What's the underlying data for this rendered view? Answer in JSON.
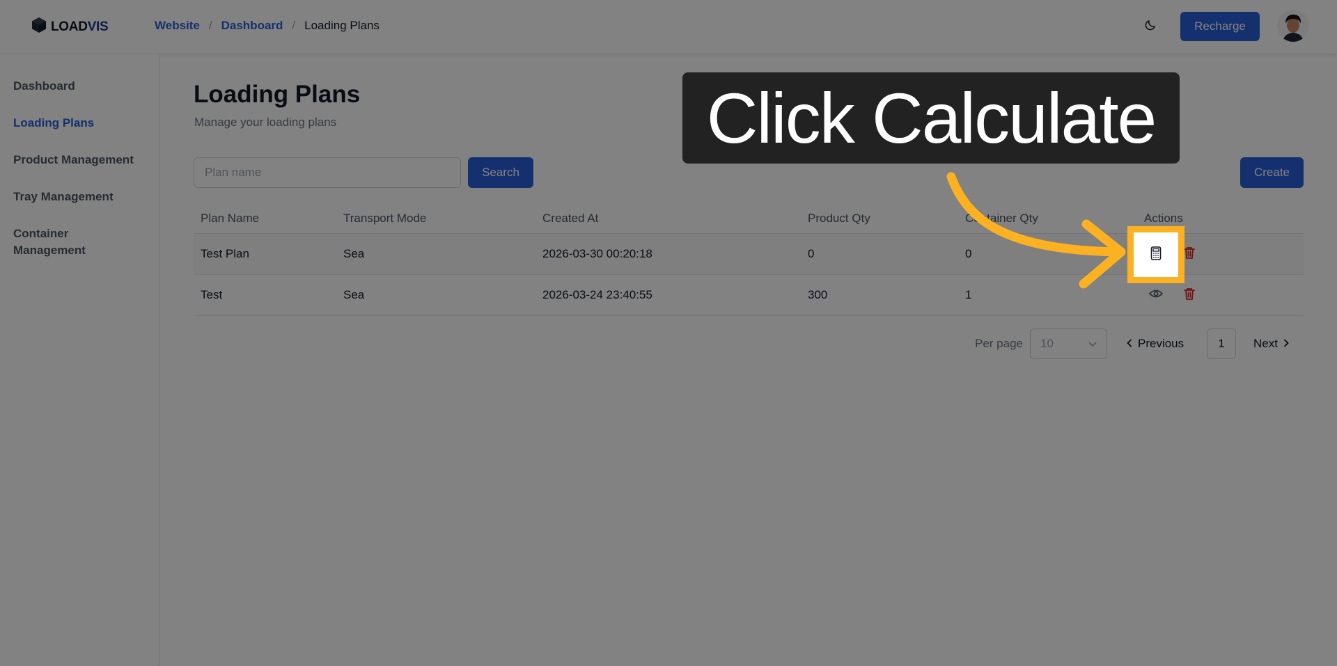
{
  "header": {
    "logo_text_a": "LOAD",
    "logo_text_b": "VIS",
    "breadcrumb": [
      "Website",
      "Dashboard",
      "Loading Plans"
    ],
    "recharge_label": "Recharge"
  },
  "sidebar": {
    "items": [
      {
        "label": "Dashboard"
      },
      {
        "label": "Loading Plans",
        "active": true
      },
      {
        "label": "Product Management"
      },
      {
        "label": "Tray Management"
      },
      {
        "label": "Container Management"
      }
    ]
  },
  "page": {
    "title": "Loading Plans",
    "subtitle": "Manage your loading plans",
    "search_placeholder": "Plan name",
    "search_label": "Search",
    "create_label": "Create"
  },
  "table": {
    "columns": [
      "Plan Name",
      "Transport Mode",
      "Created At",
      "Product Qty",
      "Container Qty",
      "Actions"
    ],
    "rows": [
      {
        "plan_name": "Test Plan",
        "transport_mode": "Sea",
        "created_at": "2026-03-30 00:20:18",
        "product_qty": "0",
        "container_qty": "0"
      },
      {
        "plan_name": "Test",
        "transport_mode": "Sea",
        "created_at": "2026-03-24 23:40:55",
        "product_qty": "300",
        "container_qty": "1"
      }
    ]
  },
  "pagination": {
    "per_page_label": "Per page",
    "per_page_value": "10",
    "previous_label": "Previous",
    "current_page": "1",
    "next_label": "Next"
  },
  "callout": {
    "text": "Click Calculate"
  },
  "colors": {
    "accent": "#2a5ed8",
    "highlight": "#fbb122",
    "danger": "#dc2626"
  }
}
